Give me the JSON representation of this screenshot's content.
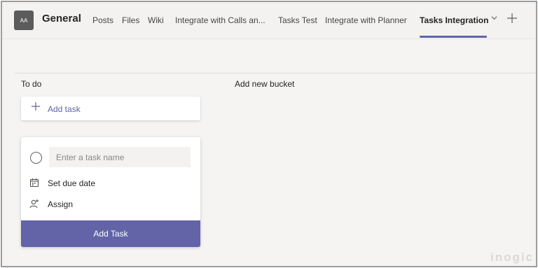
{
  "header": {
    "avatar_initials": "AA",
    "channel_title": "General",
    "tabs": [
      {
        "label": "Posts"
      },
      {
        "label": "Files"
      },
      {
        "label": "Wiki"
      },
      {
        "label": "Integrate with Calls an..."
      },
      {
        "label": "Tasks Test"
      },
      {
        "label": "Integrate with Planner"
      },
      {
        "label": "Tasks Integration"
      }
    ],
    "active_tab": "Tasks Integration",
    "accent_color": "#6264a7"
  },
  "board": {
    "bucket_title": "To do",
    "new_bucket_label": "Add new bucket",
    "add_task_label": "Add task",
    "task_form": {
      "name_placeholder": "Enter a task name",
      "due_date_label": "Set due date",
      "assign_label": "Assign",
      "submit_label": "Add Task"
    }
  },
  "icons": {
    "plus": "plus-icon",
    "calendar": "calendar-icon",
    "assign": "assign-user-icon",
    "chevron": "chevron-down-icon",
    "add_tab": "add-tab-icon"
  },
  "watermark": "inogic"
}
